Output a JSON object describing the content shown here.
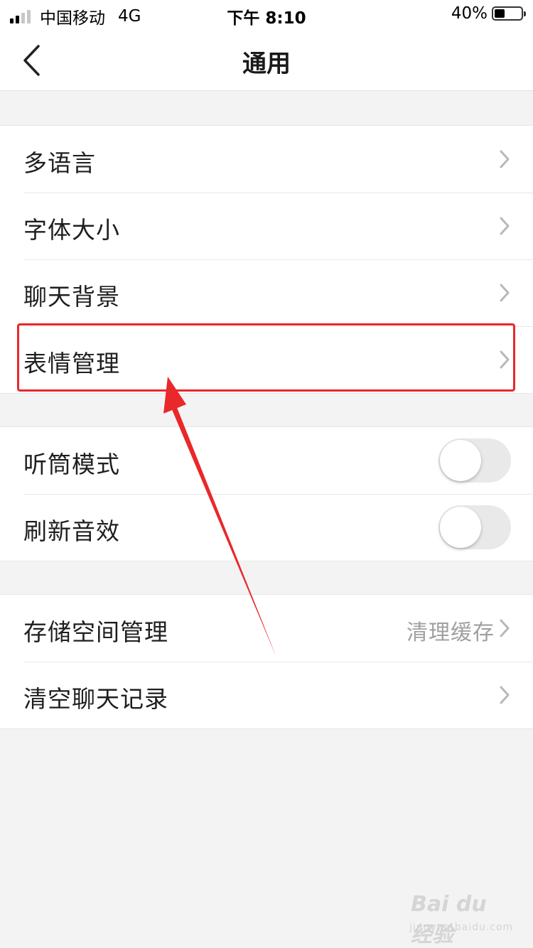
{
  "status_bar": {
    "carrier": "中国移动",
    "network": "4G",
    "time": "下午 8:10",
    "battery": "40%",
    "battery_level": 0.4,
    "signal_bars": 2
  },
  "nav": {
    "title": "通用",
    "back_icon": "chevron-left-icon"
  },
  "group1": {
    "items": [
      {
        "label": "多语言"
      },
      {
        "label": "字体大小"
      },
      {
        "label": "聊天背景"
      },
      {
        "label": "表情管理"
      }
    ]
  },
  "group2": {
    "items": [
      {
        "label": "听筒模式",
        "toggle": false
      },
      {
        "label": "刷新音效",
        "toggle": false
      }
    ]
  },
  "group3": {
    "items": [
      {
        "label": "存储空间管理",
        "value": "清理缓存"
      },
      {
        "label": "清空聊天记录"
      }
    ]
  },
  "annotation": {
    "highlight_color": "#e8282a",
    "highlighted_item": "表情管理"
  },
  "watermark": {
    "logo_text": "Bai du 经验",
    "url": "jingyan.baidu.com"
  }
}
